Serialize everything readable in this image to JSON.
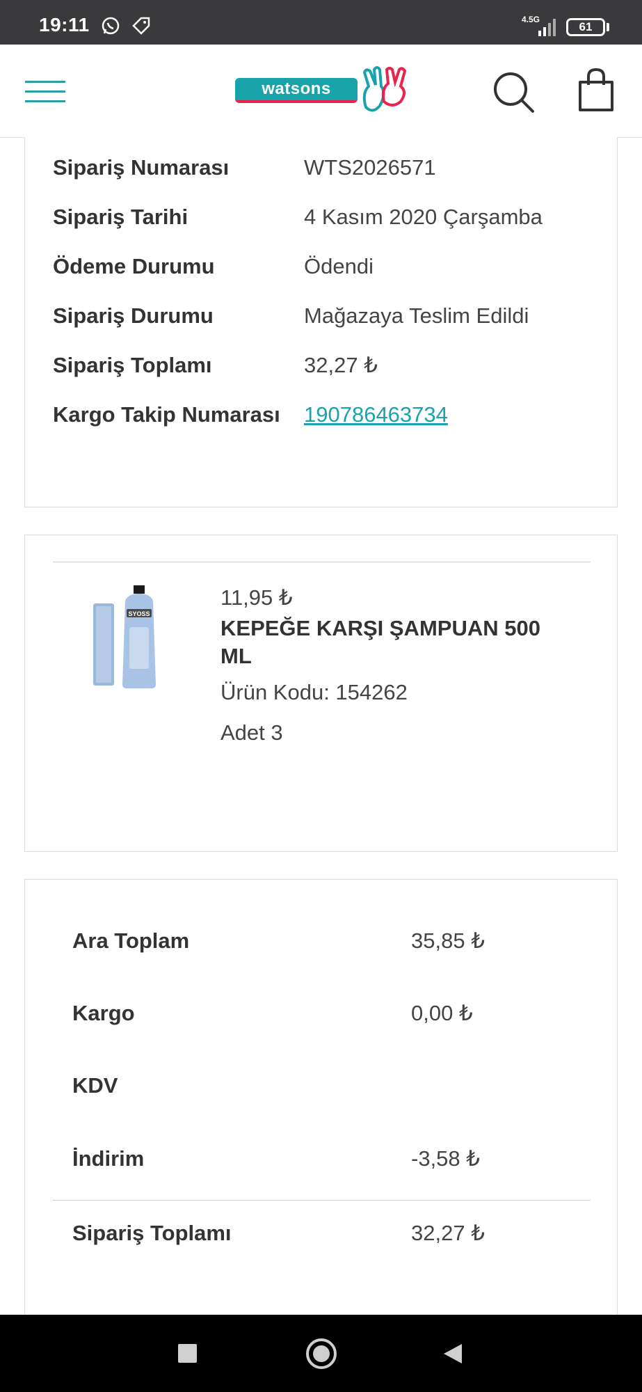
{
  "status_bar": {
    "time": "19:11",
    "network": "4.5G",
    "battery": "61",
    "icons": [
      "whatsapp-icon",
      "tag-icon",
      "signal-icon",
      "battery-icon"
    ]
  },
  "header": {
    "logo_text": "watsons",
    "icons": [
      "menu-icon",
      "search-icon",
      "shopping-bag-icon"
    ]
  },
  "order_info": {
    "rows": [
      {
        "label": "Sipariş Numarası",
        "value": "WTS2026571"
      },
      {
        "label": "Sipariş Tarihi",
        "value": "4 Kasım 2020 Çarşamba"
      },
      {
        "label": "Ödeme Durumu",
        "value": "Ödendi"
      },
      {
        "label": "Sipariş Durumu",
        "value": "Mağazaya Teslim Edildi"
      },
      {
        "label": "Sipariş Toplamı",
        "value": "32,27 ₺"
      },
      {
        "label": "Kargo Takip Numarası",
        "value": "190786463734"
      }
    ]
  },
  "product": {
    "price": "11,95 ₺",
    "name": "KEPEĞE KARŞI ŞAMPUAN 500 ML",
    "code": "Ürün Kodu: 154262",
    "quantity": "Adet 3",
    "image_brand": "SYOSS"
  },
  "summary": {
    "rows": [
      {
        "label": "Ara Toplam",
        "value": "35,85 ₺"
      },
      {
        "label": "Kargo",
        "value": "0,00 ₺"
      },
      {
        "label": "KDV",
        "value": ""
      },
      {
        "label": "İndirim",
        "value": "-3,58 ₺"
      }
    ],
    "total": {
      "label": "Sipariş Toplamı",
      "value": "32,27 ₺"
    }
  },
  "colors": {
    "brand_teal": "#18a3ab",
    "brand_red": "#e9234a",
    "link": "#1aa3ab",
    "status_bar": "#3a3a3c"
  }
}
